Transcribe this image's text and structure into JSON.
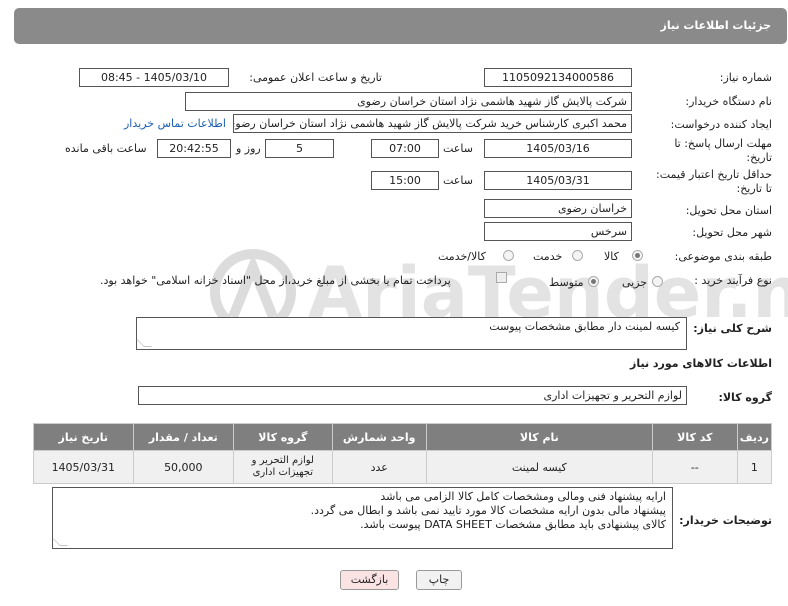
{
  "header": {
    "title": "جزئیات اطلاعات نیاز"
  },
  "fields": {
    "need_number_label": "شماره نیاز:",
    "need_number": "1105092134000586",
    "announce_label": "تاریخ و ساعت اعلان عمومی:",
    "announce_value": "1405/03/10 - 08:45",
    "buyer_org_label": "نام دستگاه خریدار:",
    "buyer_org": "شرکت پالایش گاز شهید هاشمی نژاد   استان خراسان رضوی",
    "creator_label": "ایجاد کننده درخواست:",
    "creator": "محمد اکبری کارشناس خرید شرکت پالایش گاز شهید هاشمی نژاد   استان خراسان رضوی",
    "contact_link": "اطلاعات تماس خریدار",
    "deadline_label_1": "مهلت ارسال پاسخ: تا",
    "deadline_label_2": "تاریخ:",
    "deadline_date": "1405/03/16",
    "time_label": "ساعت",
    "deadline_time": "07:00",
    "days_value": "5",
    "days_label": "روز و",
    "remaining_time": "20:42:55",
    "remaining_label": "ساعت باقی مانده",
    "min_price_label_1": "حداقل تاریخ اعتبار قیمت:",
    "min_price_label_2": "تا تاریخ:",
    "validity_date": "1405/03/31",
    "validity_time_label": "ساعت",
    "validity_time": "15:00",
    "province_label": "استان محل تحویل:",
    "province": "خراسان رضوی",
    "city_label": "شهر محل تحویل:",
    "city": "سرخس",
    "category_label": "طبقه بندی موضوعی:",
    "category_options": [
      "کالا",
      "خدمت",
      "کالا/خدمت"
    ],
    "category_selected": "کالا",
    "process_label": "نوع فرآیند خرید :",
    "process_options": [
      "جزیی",
      "متوسط"
    ],
    "process_selected": "متوسط",
    "payment_note": "پرداخت تمام یا بخشی از مبلغ خرید،از محل \"اسناد خزانه اسلامی\" خواهد بود."
  },
  "description": {
    "label": "شرح کلی نیاز:",
    "value": "کیسه لمینت دار مطابق مشخصات پیوست"
  },
  "goods_info": {
    "title": "اطلاعات کالاهای مورد نیاز",
    "group_label": "گروه کالا:",
    "group_value": "لوازم التحریر و تجهیزات اداری"
  },
  "table": {
    "headers": [
      "ردیف",
      "کد کالا",
      "نام کالا",
      "واحد شمارش",
      "گروه کالا",
      "تعداد / مقدار",
      "تاریخ نیاز"
    ],
    "rows": [
      [
        "1",
        "--",
        "کیسه لمینت",
        "عدد",
        "لوازم التحریر و تجهیزات اداری",
        "50,000",
        "1405/03/31"
      ]
    ]
  },
  "buyer_notes": {
    "label": "توضیحات خریدار:",
    "lines": [
      "ارایه پیشنهاد فنی ومالی ومشخصات کامل کالا الزامی می باشد",
      "پیشنهاد مالی بدون ارایه مشخصات کالا مورد تایید نمی باشد و ابطال می گردد.",
      "کالای پیشنهادی باید مطابق مشخصات DATA SHEET پیوست باشد."
    ]
  },
  "buttons": {
    "print": "چاپ",
    "back": "بازگشت"
  },
  "watermark": {
    "text": "AriaTender.neT"
  },
  "colors": {
    "header_bg": "#8a8a8a",
    "table_header_bg": "#7f7f7f",
    "link": "#1a5fb4",
    "back_button_bg": "#fbe3e3"
  }
}
